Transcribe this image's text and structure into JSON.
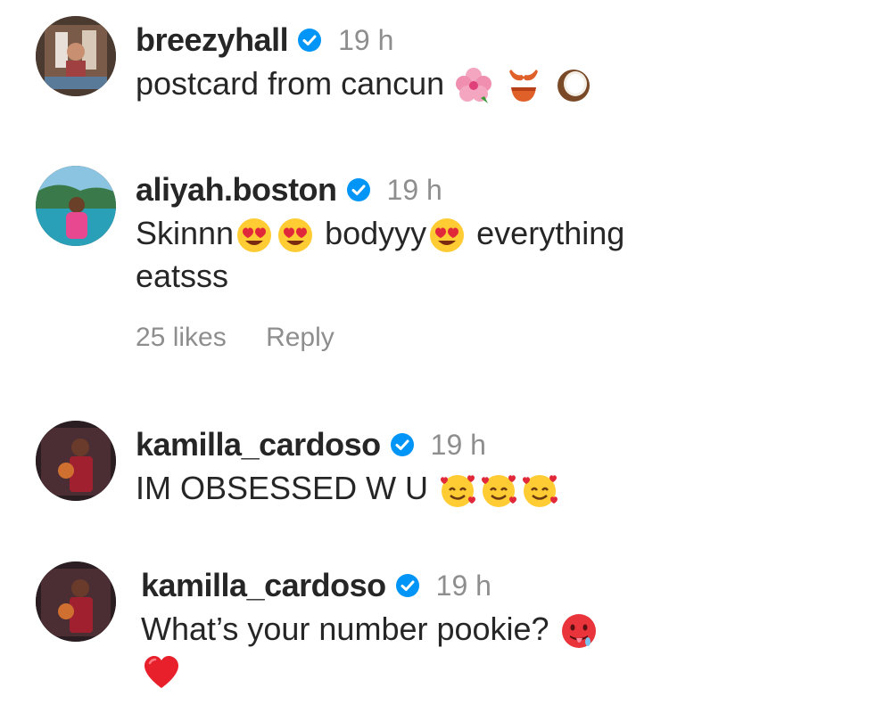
{
  "comments": [
    {
      "username": "breezyhall",
      "time": "19 h",
      "text": "postcard from cancun",
      "emojis": [
        "hibiscus-icon",
        "bikini-icon",
        "coconut-icon"
      ]
    },
    {
      "username": "aliyah.boston",
      "time": "19 h",
      "text_a": "Skinnn",
      "text_b": " bodyyy",
      "text_c": " everything",
      "text_d": "eatsss",
      "likes": "25 likes",
      "reply": "Reply"
    },
    {
      "username": "kamilla_cardoso",
      "time": "19 h",
      "text": "IM OBSESSED W U"
    },
    {
      "username": "kamilla_cardoso",
      "time": "19 h",
      "text": "What’s your number pookie?"
    }
  ],
  "colors": {
    "verified": "#0095f6",
    "text": "#262626",
    "meta": "#8e8e8e"
  }
}
